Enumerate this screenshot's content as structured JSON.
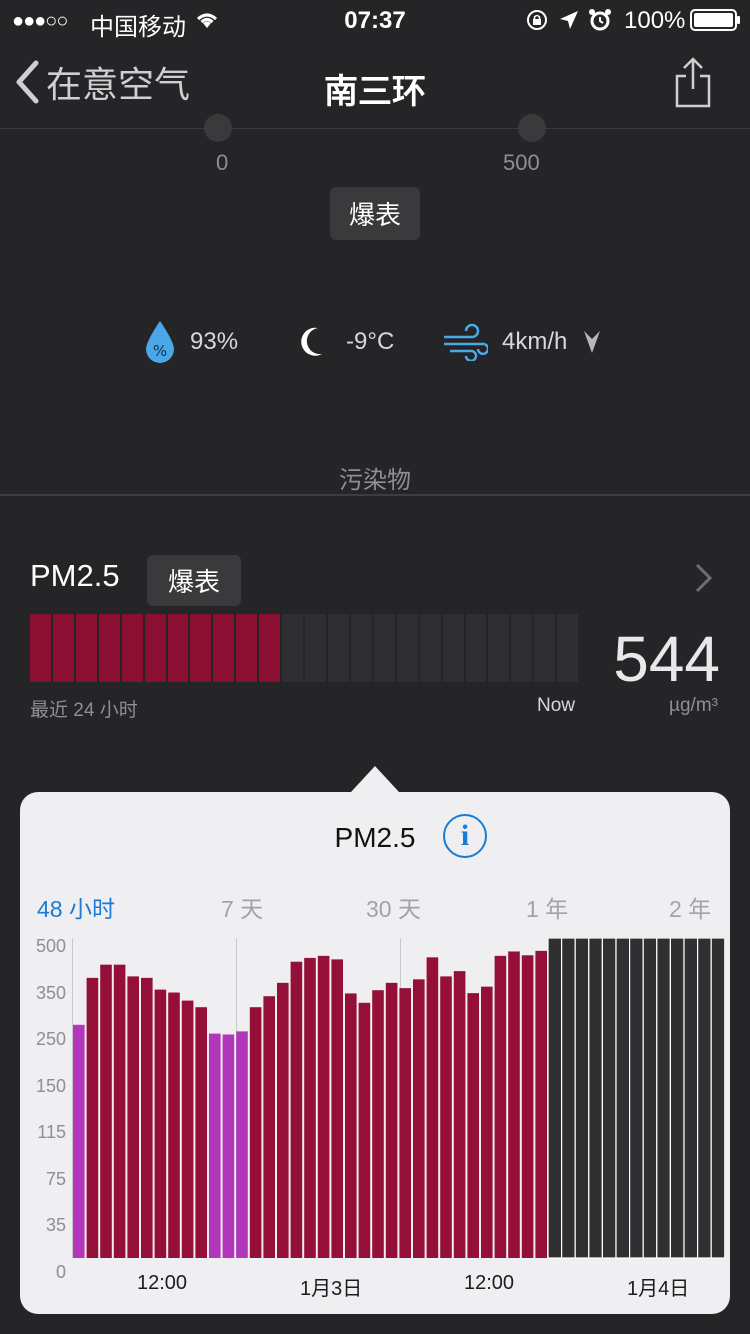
{
  "status_bar": {
    "signal": "●●●○○",
    "carrier": "中国移动",
    "time": "07:37",
    "battery": "100%"
  },
  "nav": {
    "back_label": "在意空气",
    "title": "南三环"
  },
  "scale": {
    "min": "0",
    "max": "500",
    "level": "爆表"
  },
  "weather": {
    "humidity": "93%",
    "temperature": "-9°C",
    "wind": "4km/h"
  },
  "section": {
    "label": "污染物"
  },
  "pm25": {
    "name": "PM2.5",
    "level": "爆表",
    "value": "544",
    "unit": "µg/m³",
    "range_label": "最近 24 小时",
    "now_label": "Now",
    "hours_filled": 11,
    "hours_total": 24,
    "fill_color": "#8b0f33",
    "empty_color": "#2f2f31"
  },
  "popover": {
    "title": "PM2.5",
    "info_icon": "i",
    "tabs": [
      "48 小时",
      "7 天",
      "30 天",
      "1 年",
      "2 年"
    ],
    "active_tab": 0
  },
  "chart_data": {
    "type": "bar",
    "y_ticks": [
      "500",
      "350",
      "250",
      "150",
      "115",
      "75",
      "35",
      "0"
    ],
    "x_labels": [
      "12:00",
      "1月3日",
      "12:00",
      "1月4日"
    ],
    "values": [
      280,
      405,
      450,
      450,
      410,
      405,
      365,
      355,
      335,
      320,
      260,
      258,
      265,
      320,
      345,
      388,
      460,
      473,
      480,
      468,
      352,
      330,
      363,
      388,
      370,
      400,
      475,
      410,
      428,
      353,
      375,
      480,
      495,
      482,
      497
    ],
    "categories_of_values": [
      "purple",
      "red",
      "red",
      "red",
      "red",
      "red",
      "red",
      "red",
      "red",
      "red",
      "purple",
      "purple",
      "purple",
      "red",
      "red",
      "red",
      "red",
      "red",
      "red",
      "red",
      "red",
      "red",
      "red",
      "red",
      "red",
      "red",
      "red",
      "red",
      "red",
      "red",
      "red",
      "red",
      "red",
      "red",
      "red"
    ],
    "empty_bars": 13,
    "colors": {
      "red": "#941039",
      "purple": "#b236b9",
      "empty": "#303032",
      "empty_line": "#ffffff"
    }
  }
}
